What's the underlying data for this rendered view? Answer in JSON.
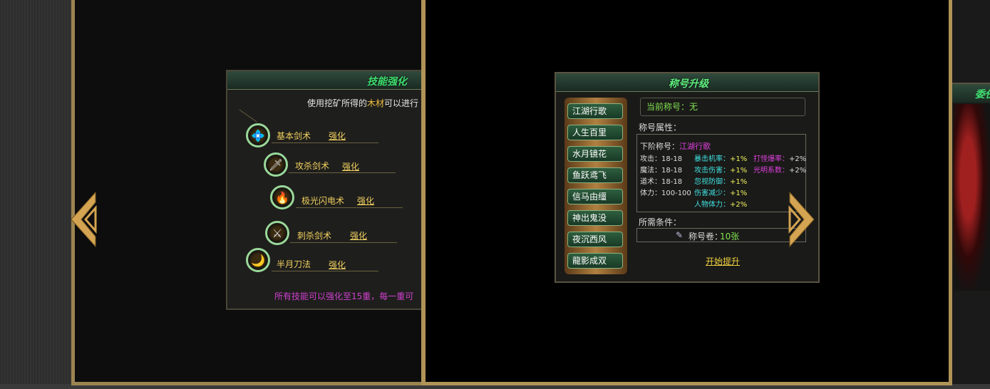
{
  "skill_panel": {
    "title": "技能强化",
    "desc_prefix": "使用挖矿所得的",
    "desc_highlight": "木材",
    "desc_suffix": "可以进行",
    "skills": [
      {
        "name": "基本剑术",
        "action": "强化",
        "icon": "💠"
      },
      {
        "name": "攻杀剑术",
        "action": "强化",
        "icon": "🗡"
      },
      {
        "name": "极光闪电术",
        "action": "强化",
        "icon": "🔥"
      },
      {
        "name": "刺杀剑术",
        "action": "强化",
        "icon": "⚔"
      },
      {
        "name": "半月刀法",
        "action": "强化",
        "icon": "🌙"
      }
    ],
    "footer": "所有技能可以强化至15重，每一重可"
  },
  "title_panel": {
    "title": "称号升级",
    "titles": [
      "江湖行歌",
      "人生百里",
      "水月镜花",
      "鱼跃鸢飞",
      "信马由缰",
      "神出鬼没",
      "夜沉西风",
      "龍影成双"
    ],
    "current_title": "当前称号：无",
    "attr_label": "称号属性：",
    "next_title_label": "下阶称号：",
    "next_title_value": "江湖行歌",
    "stats": [
      "攻击：18-18",
      "魔法：18-18",
      "道术：18-18",
      "体力：100-100"
    ],
    "bonus_col1": [
      {
        "label": "暴击机率：",
        "value": "+1%"
      },
      {
        "label": "攻击伤害：",
        "value": "+1%"
      },
      {
        "label": "忽视防御：",
        "value": "+1%"
      },
      {
        "label": "伤害减少：",
        "value": "+1%"
      },
      {
        "label": "人物体力：",
        "value": "+2%"
      }
    ],
    "bonus_col2": [
      {
        "label": "打怪爆率：",
        "value": "+2%"
      },
      {
        "label": "光明系数：",
        "value": "+2%"
      }
    ],
    "cond_label": "所需条件：",
    "cond_item": "称号卷：",
    "cond_value": "10张",
    "start_button": "开始提升"
  },
  "peek_panel": {
    "title": "委任"
  },
  "arrows": {
    "left": "prev-arrow-icon",
    "right": "next-arrow-icon",
    "color": "#d4a452"
  }
}
